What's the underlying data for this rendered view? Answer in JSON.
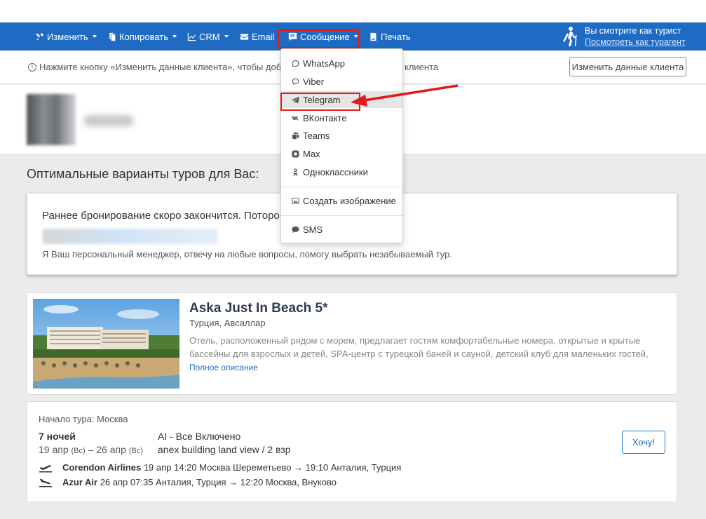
{
  "toolbar": {
    "items": [
      {
        "label": "Изменить",
        "icon": "tools-icon"
      },
      {
        "label": "Копировать",
        "icon": "copy-icon"
      },
      {
        "label": "CRM",
        "icon": "chart-icon"
      },
      {
        "label": "Email",
        "icon": "envelope-icon"
      },
      {
        "label": "Сообщение",
        "icon": "message-icon"
      },
      {
        "label": "Печать",
        "icon": "printer-icon"
      }
    ],
    "tourist_line": "Вы смотрите как турист",
    "tourist_link": "Посмотреть как турагент",
    "highlight_color": "#e01a1a"
  },
  "infobar": {
    "text_left": "Нажмите кнопку «Изменить данные клиента», чтобы добав",
    "text_right": "клиента",
    "edit_button": "Изменить данные клиента"
  },
  "dropdown": {
    "items": [
      {
        "label": "WhatsApp",
        "icon": "whatsapp-icon"
      },
      {
        "label": "Viber",
        "icon": "viber-icon"
      },
      {
        "label": "Telegram",
        "icon": "telegram-icon"
      },
      {
        "label": "ВКонтакте",
        "icon": "vk-icon"
      },
      {
        "label": "Teams",
        "icon": "teams-icon"
      },
      {
        "label": "Max",
        "icon": "max-icon"
      },
      {
        "label": "Одноклассники",
        "icon": "odnoklassniki-icon"
      }
    ],
    "image_item": "Создать изображение",
    "sms_item": "SMS"
  },
  "section_title": "Оптимальные варианты туров для Вас:",
  "offer": {
    "line1": "Раннее бронирование скоро закончится. Потoро",
    "line2": "Я Ваш персональный менеджер, отвечу на любые вопросы, помогу выбрать незабываемый тур."
  },
  "hotel": {
    "name": "Aska Just In Beach 5*",
    "location": "Турция, Авсаллар",
    "description": "Отель, расположенный рядом с морем, предлагает гостям комфортабельные номера, открытые и крытые бассейны для взрослых и детей, SPA-центр с турецкой баней и сауной, детский клуб для маленьких гостей,",
    "full_link": "Полное описание"
  },
  "tour": {
    "start": "Начало тура: Москва",
    "nights": "7 ночей",
    "dates_from": "19 апр",
    "day_from": "(Вс)",
    "dates_sep": "– 26 апр",
    "day_to": "(Вс)",
    "meal": "AI - Все Включено",
    "room": "anex building land view / 2 взр",
    "want_button": "Хочу!",
    "flights": [
      {
        "airline": "Corendon Airlines",
        "details": "19 апр 14:20 Москва Шереметьево → 19:10 Анталия, Турция",
        "icon": "plane-departure-icon"
      },
      {
        "airline": "Azur Air",
        "details": "26 апр 07:35 Анталия, Турция → 12:20 Москва, Внуково",
        "icon": "plane-arrival-icon"
      }
    ]
  }
}
